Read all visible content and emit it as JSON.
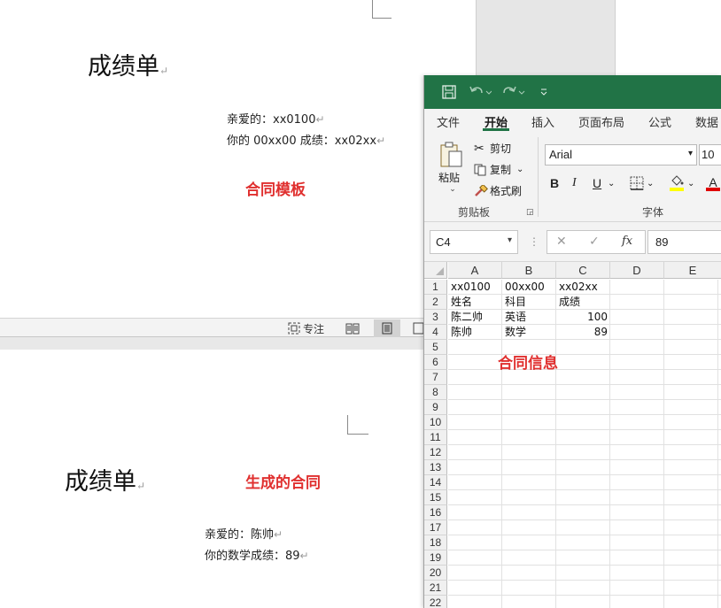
{
  "word_top": {
    "title": "成绩单",
    "line1": "亲爱的：xx0100",
    "line2": "你的 00xx00 成绩：xx02xx",
    "annotation": "合同模板",
    "paragraph_mark": "↵"
  },
  "word_status": {
    "focus_label": "专注"
  },
  "word_bottom": {
    "title": "成绩单",
    "line1": "亲爱的：陈帅",
    "line2": "你的数学成绩：89",
    "annotation": "生成的合同",
    "paragraph_mark": "↵"
  },
  "excel": {
    "tabs": [
      "文件",
      "开始",
      "插入",
      "页面布局",
      "公式",
      "数据"
    ],
    "active_tab": "开始",
    "clipboard": {
      "paste": "粘贴",
      "cut": "剪切",
      "copy": "复制",
      "format_painter": "格式刷",
      "group_label": "剪贴板"
    },
    "font": {
      "name": "Arial",
      "size": "10",
      "group_label": "字体",
      "bold": "B",
      "italic": "I",
      "underline": "U",
      "font_color_letter": "A"
    },
    "name_box": "C4",
    "formula_value": "89",
    "fx_label": "fx",
    "columns": [
      "A",
      "B",
      "C",
      "D",
      "E"
    ],
    "rows": [
      "1",
      "2",
      "3",
      "4",
      "5",
      "6",
      "7",
      "8",
      "9",
      "10",
      "11",
      "12",
      "13",
      "14",
      "15",
      "16",
      "17",
      "18",
      "19",
      "20",
      "21",
      "22"
    ],
    "cells": {
      "A1": "xx0100",
      "B1": "00xx00",
      "C1": "xx02xx",
      "A2": "姓名",
      "B2": "科目",
      "C2": "成绩",
      "A3": "陈二帅",
      "B3": "英语",
      "C3": "100",
      "A4": "陈帅",
      "B4": "数学",
      "C4": "89"
    },
    "annotation": "合同信息",
    "colors": {
      "title_bar": "#217346",
      "annotation": "#e0302f"
    }
  }
}
